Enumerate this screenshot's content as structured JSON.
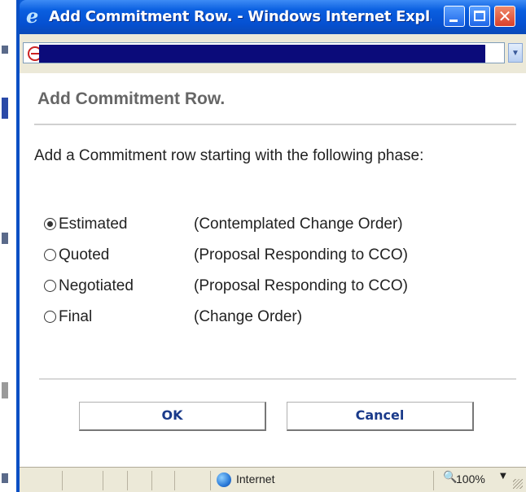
{
  "window": {
    "title": "Add Commitment Row. - Windows Internet Expl...",
    "icon": "ie-icon",
    "controls": [
      "minimize-icon",
      "maximize-icon",
      "close-icon"
    ]
  },
  "address_bar": {
    "icon": "page-icon",
    "value": ""
  },
  "dialog": {
    "title": "Add Commitment Row.",
    "instruction": "Add a Commitment row starting with the following phase:",
    "options": [
      {
        "name": "Estimated",
        "description": "(Contemplated Change Order)",
        "selected": true
      },
      {
        "name": "Quoted",
        "description": "(Proposal Responding to CCO)",
        "selected": false
      },
      {
        "name": "Negotiated",
        "description": "(Proposal Responding to CCO)",
        "selected": false
      },
      {
        "name": "Final",
        "description": "(Change Order)",
        "selected": false
      }
    ],
    "ok_label": "OK",
    "cancel_label": "Cancel"
  },
  "status_bar": {
    "zone": "Internet",
    "zoom": "100%"
  },
  "colors": {
    "title_bar": "#0a5fe0",
    "address_redaction": "#0b0b7a",
    "button_text": "#1a3a8a"
  }
}
